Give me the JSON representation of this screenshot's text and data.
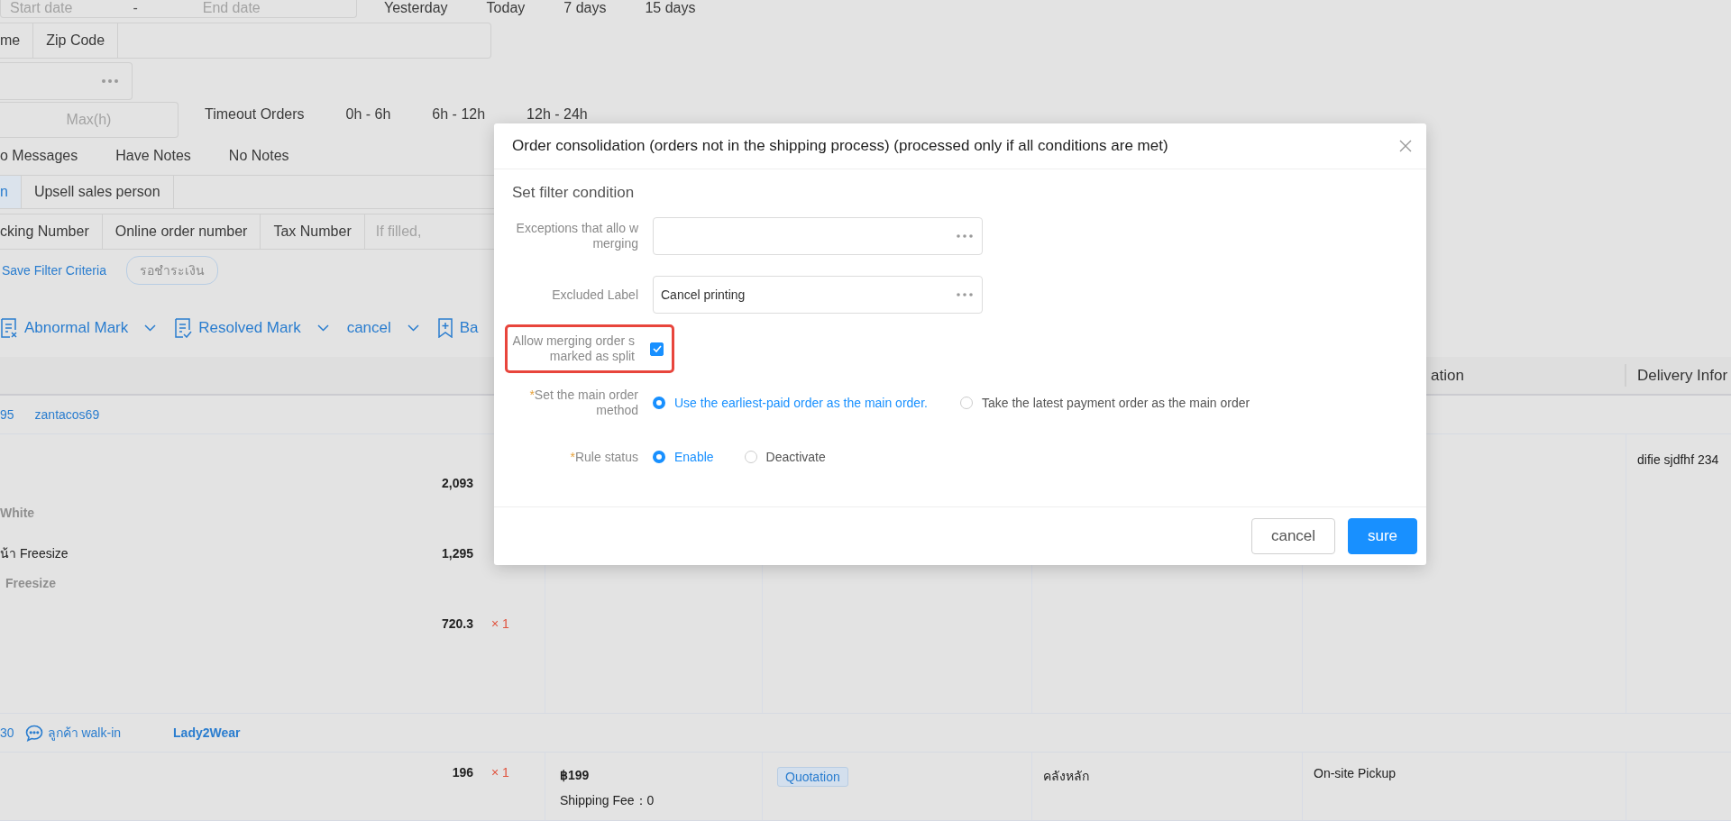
{
  "filters": {
    "date_range": {
      "start_placeholder": "Start date",
      "separator": "-",
      "end_placeholder": "End date"
    },
    "date_shortcuts": [
      "Yesterday",
      "Today",
      "7 days",
      "15 days"
    ],
    "address_tabs": [
      {
        "label": "me",
        "selected": false
      },
      {
        "label": "Zip Code",
        "selected": false
      }
    ],
    "hours": {
      "max_placeholder": "Max(h)"
    },
    "timeout": {
      "label": "Timeout Orders",
      "options": [
        "0h - 6h",
        "6h - 12h",
        "12h - 24h"
      ]
    },
    "note_options": [
      "o Messages",
      "Have Notes",
      "No Notes"
    ],
    "person_tabs": [
      {
        "label": "n",
        "selected": true
      },
      {
        "label": "Upsell sales person",
        "selected": false
      }
    ],
    "number_tabs": [
      {
        "label": "cking Number",
        "selected": false
      },
      {
        "label": "Online order number",
        "selected": false
      },
      {
        "label": "Tax Number",
        "selected": false
      }
    ],
    "number_placeholder": "If filled,",
    "save_filter": "Save Filter Criteria",
    "saved_tags": [
      "รอชำระเงิน"
    ]
  },
  "toolbar": [
    {
      "label": "Abnormal Mark",
      "kind": "abnormal",
      "dropdown": true
    },
    {
      "label": "Resolved Mark",
      "kind": "resolved",
      "dropdown": true
    },
    {
      "label": "cancel",
      "kind": "plain",
      "dropdown": true
    },
    {
      "label": "Ba",
      "kind": "bookmark",
      "dropdown": false
    }
  ],
  "table": {
    "columns": [
      {
        "label": "ation"
      },
      {
        "label": "Delivery Infor"
      }
    ],
    "groups": [
      {
        "order_no": "95",
        "buyer": "zantacos69",
        "items": [
          {
            "price": "2,093",
            "variant": "White"
          },
          {
            "name": "น้า Freesize",
            "price": "1,295",
            "variant": "Freesize"
          },
          {
            "price": "720.3",
            "qty": "× 1"
          }
        ],
        "delivery_info": "difie sjdfhf 234"
      },
      {
        "order_no": "30",
        "note": "ลูกค้า walk-in",
        "shop": "Lady2Wear",
        "items": [
          {
            "price": "196",
            "qty": "× 1"
          }
        ],
        "total": "฿199",
        "shipping": "Shipping Fee：0",
        "tag": "Quotation",
        "warehouse": "คลังหลัก",
        "delivery": "On-site Pickup"
      }
    ]
  },
  "dialog": {
    "title": "Order consolidation (orders not in the shipping process) (processed only if all conditions are met)",
    "section": "Set filter condition",
    "fields": [
      {
        "kind": "select",
        "label": "Exceptions that allo w merging"
      },
      {
        "kind": "select",
        "label": "Excluded Label",
        "value": "Cancel printing"
      },
      {
        "kind": "checkbox",
        "label": "Allow merging order s marked as split",
        "checked": true,
        "highlighted": true
      },
      {
        "kind": "radio",
        "label": "Set the main order method",
        "required_mark": "*",
        "options": [
          {
            "label": "Use the earliest-paid order as the main order.",
            "selected": true
          },
          {
            "label": "Take the latest payment order as the main order",
            "selected": false
          }
        ]
      },
      {
        "kind": "radio",
        "label": "Rule status",
        "required_mark": "*",
        "options": [
          {
            "label": "Enable",
            "selected": true
          },
          {
            "label": "Deactivate",
            "selected": false
          }
        ]
      }
    ],
    "buttons": [
      {
        "label": "cancel",
        "kind": "secondary"
      },
      {
        "label": "sure",
        "kind": "primary"
      }
    ]
  }
}
